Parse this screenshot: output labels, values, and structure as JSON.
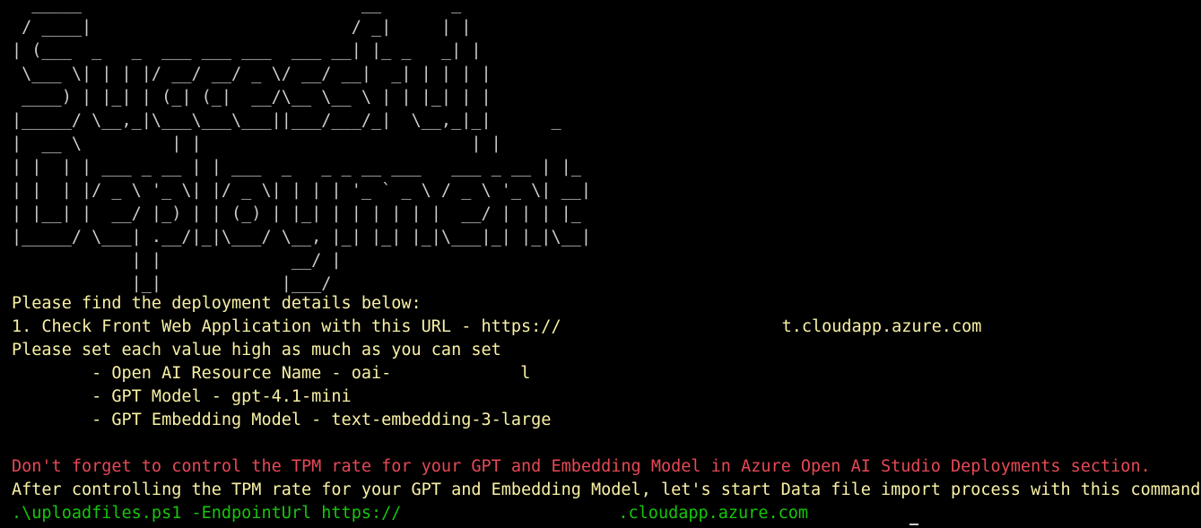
{
  "banner": {
    "ascii_art": "  _____                            __       _ \n / ____|                          / _|     | |\n| (___  _   _  ___ ___ ___  ___ __| |_ _   _| |\n \\___ \\| | | |/ __/ __/ _ \\/ __/ __|  _| | | | |\n ____) | |_| | (_| (_|  __/\\__ \\__ \\ | | |_| | |\n|_____/ \\__,_|\\___\\___\\___||___/___/_|  \\__,_|_|      _\n|  __ \\         | |                           | |\n| |  | | ___ _ __ | | ___  _   _ _ __ ___   ___ _ __ | |_\n| |  | |/ _ \\ '_ \\| |/ _ \\| | | | '_ ` _ \\ / _ \\ '_ \\| __|\n| |__| |  __/ |_) | | (_) | |_| | | | | | |  __/ | | | |_\n|_____/ \\___| .__/|_|\\___/ \\__, |_| |_| |_|\\___|_| |_|\\__|\n            | |             __/ |\n            |_|            |___/"
  },
  "output": {
    "intro": "Please find the deployment details below:",
    "web_app_prefix": "1. Check Front Web Application with this URL - https://",
    "web_app_suffix": "t.cloudapp.azure.com",
    "set_value_note": "Please set each value high as much as you can set",
    "openai_resource_prefix": "        - Open AI Resource Name - oai-",
    "openai_resource_suffix": "l",
    "gpt_model": "        - GPT Model - gpt-4.1-mini",
    "gpt_embedding_model": "        - GPT Embedding Model - text-embedding-3-large",
    "tpm_warning": "Don't forget to control the TPM rate for your GPT and Embedding Model in Azure Open AI Studio Deployments section.",
    "import_instruction": "After controlling the TPM rate for your GPT and Embedding Model, let's start Data file import process with this command.",
    "command_prefix": ".\\uploadfiles.ps1 -EndpointUrl https://",
    "command_suffix": ".cloudapp.azure.com"
  },
  "colors": {
    "background": "#000000",
    "default_text": "#cccccc",
    "info_text": "#f9f1a5",
    "warning_text": "#e74856",
    "command_text": "#16c60c"
  }
}
